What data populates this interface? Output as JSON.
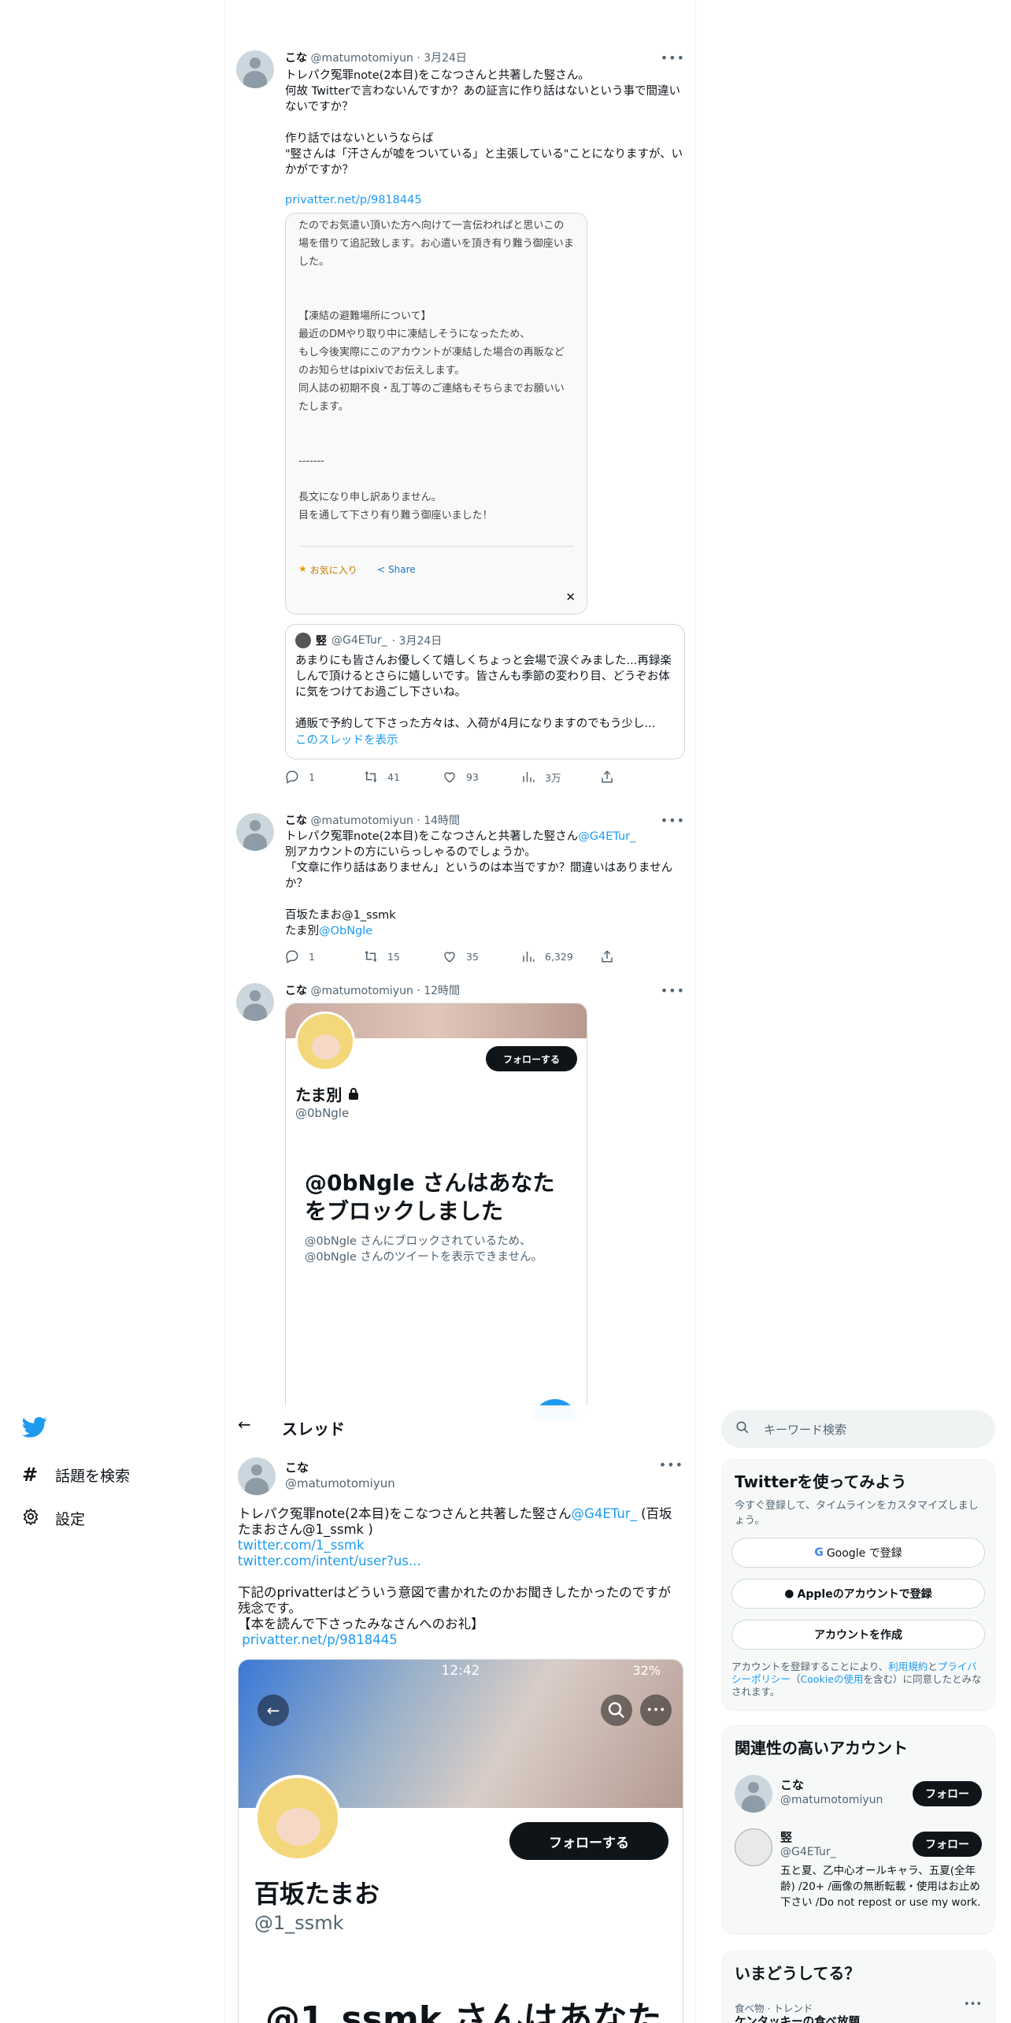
{
  "t1": {
    "name": "こな",
    "handle": "@matumotomiyun",
    "date": "· 3月24日",
    "text": "トレパク冤罪note(2本目)をこなつさんと共著した竪さん。\n何故 Twitterで言わないんですか？あの証言に作り話はないという事で間違いないですか？\n\n作り話ではないというならば\n\"竪さんは「汗さんが嘘をついている」と主張している\"ことになりますが、いかがですか？",
    "link": "privatter.net/p/9818445",
    "embed_text": "たのでお気遣い頂いた方へ向けて一言伝われぱと思いこの場を借りて追記致します。お心遣いを頂き有り難う御座いました。\n\n\n【凍結の避難場所について】\n最近のDMやり取り中に凍結しそうになったため、\nもし今後実際にこのアカウントが凍結した場合の再販などのお知らせはpixivでお伝えします。\n同人誌の初期不良・乱丁等のご連絡もそちらまでお願いいたします。\n\n\n-------\n\n長文になり申し訳ありません。\n目を通して下さり有り難う御座いました！",
    "embed_fav": "お気に入り",
    "embed_share": "Share",
    "embed_close": "✕",
    "quote_name": "竪",
    "quote_handle": "@G4ETur_",
    "quote_date": "· 3月24日",
    "quote_text": "あまりにも皆さんお優しくて嬉しくちょっと会場で涙ぐみました...再録楽しんで頂けるとさらに嬉しいです。皆さんも季節の変わり目、どうぞお体に気をつけてお過ごし下さいね。\n\n通販で予約して下さった方々は、入荷が4月になりますのでもう少し...",
    "quote_thread": "このスレッドを表示",
    "replies": "1",
    "retweets": "41",
    "likes": "93",
    "views": "3万"
  },
  "t2": {
    "name": "こな",
    "handle": "@matumotomiyun",
    "date": "· 14時間",
    "text_a": "トレパク冤罪note(2本目)をこなつさんと共著した竪さん",
    "mention": "@G4ETur_",
    "text_b": "別アカウントの方にいらっしゃるのでしょうか。\n「文章に作り話はありません」というのは本当ですか？間違いはありませんか？\n\n百坂たまお@1_ssmk\nたま別",
    "mention2": "@ObNgle",
    "replies": "1",
    "retweets": "15",
    "likes": "35",
    "views": "6,329"
  },
  "t3": {
    "name": "こな",
    "handle": "@matumotomiyun",
    "date": "· 12時間",
    "follow_btn": "フォローする",
    "profile_name": "たま別",
    "profile_handle": "@0bNgle",
    "blocked_title": "@0bNgle さんはあなたをブロックしました",
    "blocked_sub": "@0bNgle さんにブロックされているため、@0bNgle さんのツイートを表示できません。"
  },
  "left_nav": {
    "explore": "話題を検索",
    "settings": "設定"
  },
  "thread": {
    "back": "←",
    "title": "スレッド",
    "name": "こな",
    "handle": "@matumotomiyun",
    "text_a": "トレパク冤罪note(2本目)をこなつさんと共著した竪さん",
    "mention": "@G4ETur_",
    "text_b": " (百坂たまおさん@1_ssmk )",
    "link1": "twitter.com/1_ssmk",
    "link2": "twitter.com/intent/user?us...",
    "text_c": "下記のprivatterはどういう意図で書かれたのかお聞きしたかったのですが残念です。\n【本を読んで下さったみなさんへのお礼】",
    "link3": "privatter.net/p/9818445",
    "phone_time": "12:42",
    "phone_status": "32%",
    "follow_btn": "フォローする",
    "profile_name": "百坂たまお",
    "profile_handle": "@1_ssmk",
    "blocked_title": "@1_ssmk さんはあなた"
  },
  "right": {
    "search_placeholder": "キーワード検索",
    "signup_title": "Twitterを使ってみよう",
    "signup_sub": "今すぐ登録して、タイムラインをカスタマイズしましょう。",
    "google_btn": "Google で登録",
    "apple_btn": "Appleのアカウントで登録",
    "create_btn": "アカウントを作成",
    "terms_a": "アカウントを登録することにより、",
    "terms_link1": "利用規約",
    "terms_b": "と",
    "terms_link2": "プライバシーポリシー",
    "terms_c": "（",
    "terms_link3": "Cookieの使用",
    "terms_d": "を含む）に同意したとみなされます。",
    "related_title": "関連性の高いアカウント",
    "acc1_name": "こな",
    "acc1_handle": "@matumotomiyun",
    "acc2_name": "竪",
    "acc2_handle": "@G4ETur_",
    "acc2_bio": "五と夏、乙中心オールキャラ、五夏(全年齢) /20+ /画像の無断転載・使用はお止め下さい /Do not repost or use my work.",
    "follow_label": "フォロー",
    "trend_title": "いまどうしてる？",
    "trend_cat": "食べ物 · トレンド",
    "trend_name": "ケンタッキーの食べ放題"
  },
  "colors": {
    "accent": "#1d9bf0",
    "dark": "#0f1419",
    "muted": "#536471"
  }
}
